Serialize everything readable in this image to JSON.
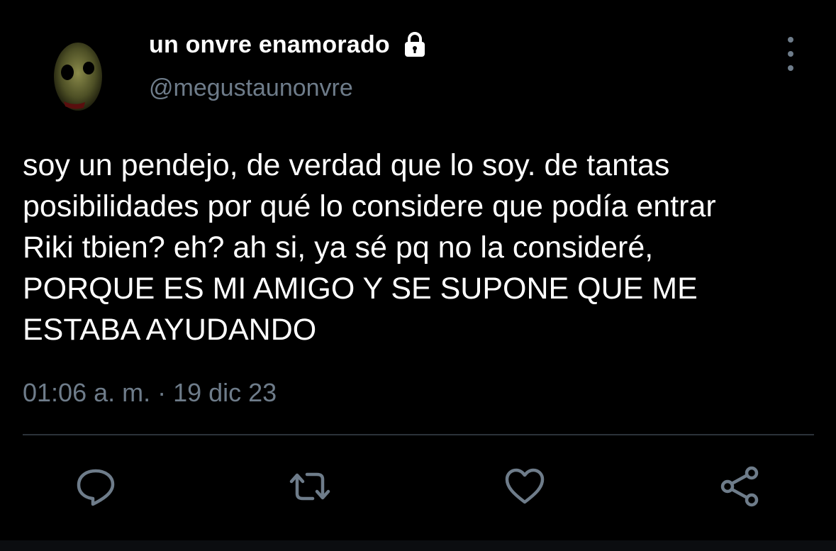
{
  "user": {
    "display_name": "un onvre enamorado",
    "handle": "@megustaunonvre",
    "avatar_icon": "avatar-image",
    "lock_icon": "lock-icon"
  },
  "tweet": {
    "text": "soy un pendejo, de verdad que lo soy. de tantas\nposibilidades por qué lo considere que podía entrar\nRiki tbien? eh? ah si, ya sé pq no la consideré,\nPORQUE ES MI AMIGO Y SE SUPONE QUE ME\nESTABA AYUDANDO",
    "timestamp": "01:06 a. m. · 19 dic 23"
  },
  "actions": [
    {
      "name": "reply",
      "icon": "reply-icon"
    },
    {
      "name": "retweet",
      "icon": "retweet-icon"
    },
    {
      "name": "like",
      "icon": "heart-icon"
    },
    {
      "name": "share",
      "icon": "share-icon"
    }
  ],
  "colors": {
    "background": "#000000",
    "primary_text": "#ffffff",
    "secondary_text": "#6e7c8a",
    "divider": "#2b3239"
  }
}
